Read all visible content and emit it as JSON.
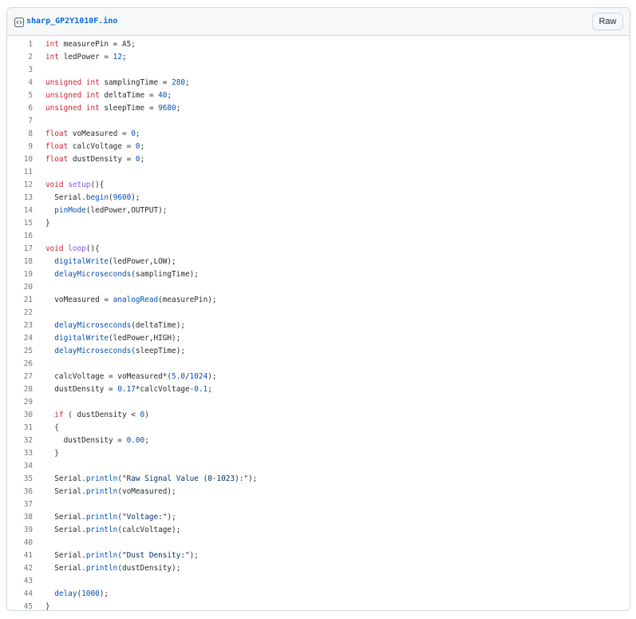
{
  "header": {
    "file_name": "sharp_GP2Y1010F.ino",
    "raw_label": "Raw",
    "icon": "code-file-icon"
  },
  "code_lines": [
    [
      [
        "kw",
        "int"
      ],
      [
        "t",
        " measurePin = A5;"
      ]
    ],
    [
      [
        "kw",
        "int"
      ],
      [
        "t",
        " ledPower = "
      ],
      [
        "num",
        "12"
      ],
      [
        "t",
        ";"
      ]
    ],
    [],
    [
      [
        "kw",
        "unsigned"
      ],
      [
        "t",
        " "
      ],
      [
        "kw",
        "int"
      ],
      [
        "t",
        " samplingTime = "
      ],
      [
        "num",
        "280"
      ],
      [
        "t",
        ";"
      ]
    ],
    [
      [
        "kw",
        "unsigned"
      ],
      [
        "t",
        " "
      ],
      [
        "kw",
        "int"
      ],
      [
        "t",
        " deltaTime = "
      ],
      [
        "num",
        "40"
      ],
      [
        "t",
        ";"
      ]
    ],
    [
      [
        "kw",
        "unsigned"
      ],
      [
        "t",
        " "
      ],
      [
        "kw",
        "int"
      ],
      [
        "t",
        " sleepTime = "
      ],
      [
        "num",
        "9680"
      ],
      [
        "t",
        ";"
      ]
    ],
    [],
    [
      [
        "kw",
        "float"
      ],
      [
        "t",
        " voMeasured = "
      ],
      [
        "num",
        "0"
      ],
      [
        "t",
        ";"
      ]
    ],
    [
      [
        "kw",
        "float"
      ],
      [
        "t",
        " calcVoltage = "
      ],
      [
        "num",
        "0"
      ],
      [
        "t",
        ";"
      ]
    ],
    [
      [
        "kw",
        "float"
      ],
      [
        "t",
        " dustDensity = "
      ],
      [
        "num",
        "0"
      ],
      [
        "t",
        ";"
      ]
    ],
    [],
    [
      [
        "kw",
        "void"
      ],
      [
        "t",
        " "
      ],
      [
        "fn",
        "setup"
      ],
      [
        "t",
        "(){"
      ]
    ],
    [
      [
        "t",
        "  Serial."
      ],
      [
        "ard",
        "begin"
      ],
      [
        "t",
        "("
      ],
      [
        "num",
        "9600"
      ],
      [
        "t",
        ");"
      ]
    ],
    [
      [
        "t",
        "  "
      ],
      [
        "ard",
        "pinMode"
      ],
      [
        "t",
        "(ledPower,OUTPUT);"
      ]
    ],
    [
      [
        "t",
        "}"
      ]
    ],
    [],
    [
      [
        "kw",
        "void"
      ],
      [
        "t",
        " "
      ],
      [
        "fn",
        "loop"
      ],
      [
        "t",
        "(){"
      ]
    ],
    [
      [
        "t",
        "  "
      ],
      [
        "ard",
        "digitalWrite"
      ],
      [
        "t",
        "(ledPower,LOW);"
      ]
    ],
    [
      [
        "t",
        "  "
      ],
      [
        "ard",
        "delayMicroseconds"
      ],
      [
        "t",
        "(samplingTime);"
      ]
    ],
    [],
    [
      [
        "t",
        "  voMeasured = "
      ],
      [
        "ard",
        "analogRead"
      ],
      [
        "t",
        "(measurePin);"
      ]
    ],
    [],
    [
      [
        "t",
        "  "
      ],
      [
        "ard",
        "delayMicroseconds"
      ],
      [
        "t",
        "(deltaTime);"
      ]
    ],
    [
      [
        "t",
        "  "
      ],
      [
        "ard",
        "digitalWrite"
      ],
      [
        "t",
        "(ledPower,HIGH);"
      ]
    ],
    [
      [
        "t",
        "  "
      ],
      [
        "ard",
        "delayMicroseconds"
      ],
      [
        "t",
        "(sleepTime);"
      ]
    ],
    [],
    [
      [
        "t",
        "  calcVoltage = voMeasured*("
      ],
      [
        "num",
        "5.0"
      ],
      [
        "t",
        "/"
      ],
      [
        "num",
        "1024"
      ],
      [
        "t",
        ");"
      ]
    ],
    [
      [
        "t",
        "  dustDensity = "
      ],
      [
        "num",
        "0.17"
      ],
      [
        "t",
        "*calcVoltage-"
      ],
      [
        "num",
        "0.1"
      ],
      [
        "t",
        ";"
      ]
    ],
    [],
    [
      [
        "t",
        "  "
      ],
      [
        "kw",
        "if"
      ],
      [
        "t",
        " ( dustDensity < "
      ],
      [
        "num",
        "0"
      ],
      [
        "t",
        ")"
      ]
    ],
    [
      [
        "t",
        "  {"
      ]
    ],
    [
      [
        "t",
        "    dustDensity = "
      ],
      [
        "num",
        "0.00"
      ],
      [
        "t",
        ";"
      ]
    ],
    [
      [
        "t",
        "  }"
      ]
    ],
    [],
    [
      [
        "t",
        "  Serial."
      ],
      [
        "ard",
        "println"
      ],
      [
        "t",
        "("
      ],
      [
        "str",
        "\"Raw Signal Value (0-1023):\""
      ],
      [
        "t",
        ");"
      ]
    ],
    [
      [
        "t",
        "  Serial."
      ],
      [
        "ard",
        "println"
      ],
      [
        "t",
        "(voMeasured);"
      ]
    ],
    [],
    [
      [
        "t",
        "  Serial."
      ],
      [
        "ard",
        "println"
      ],
      [
        "t",
        "("
      ],
      [
        "str",
        "\"Voltage:\""
      ],
      [
        "t",
        ");"
      ]
    ],
    [
      [
        "t",
        "  Serial."
      ],
      [
        "ard",
        "println"
      ],
      [
        "t",
        "(calcVoltage);"
      ]
    ],
    [],
    [
      [
        "t",
        "  Serial."
      ],
      [
        "ard",
        "println"
      ],
      [
        "t",
        "("
      ],
      [
        "str",
        "\"Dust Density:\""
      ],
      [
        "t",
        ");"
      ]
    ],
    [
      [
        "t",
        "  Serial."
      ],
      [
        "ard",
        "println"
      ],
      [
        "t",
        "(dustDensity);"
      ]
    ],
    [],
    [
      [
        "t",
        "  "
      ],
      [
        "ard",
        "delay"
      ],
      [
        "t",
        "("
      ],
      [
        "num",
        "1000"
      ],
      [
        "t",
        ");"
      ]
    ],
    [
      [
        "t",
        "}"
      ]
    ]
  ]
}
